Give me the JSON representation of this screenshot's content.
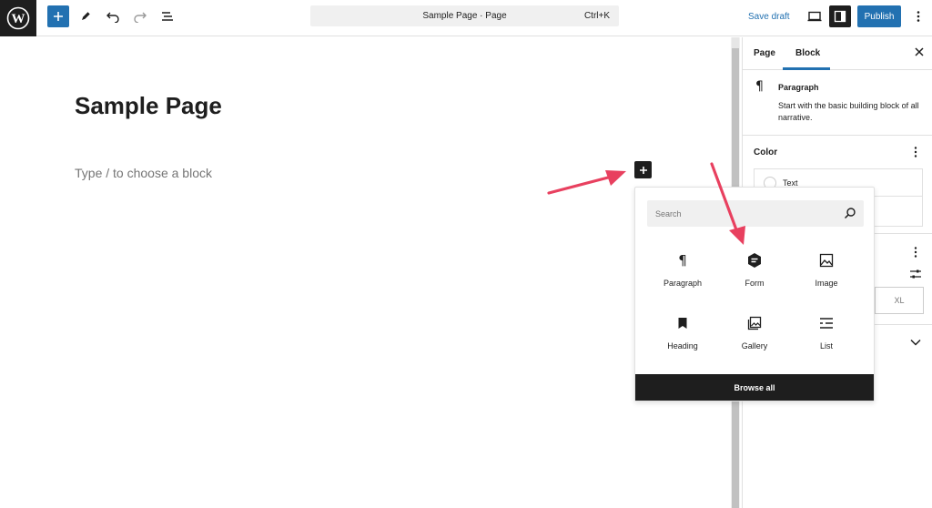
{
  "topbar": {
    "document_title": "Sample Page · Page",
    "shortcut": "Ctrl+K",
    "save_draft": "Save draft",
    "publish": "Publish"
  },
  "editor": {
    "title": "Sample Page",
    "block_placeholder": "Type / to choose a block"
  },
  "sidebar": {
    "tabs": [
      "Page",
      "Block"
    ],
    "active_tab": "Block",
    "block_card": {
      "title": "Paragraph",
      "description": "Start with the basic building block of all narrative."
    },
    "color_section": {
      "title": "Color",
      "text_label": "Text"
    },
    "size_option": "XL"
  },
  "inserter": {
    "search_placeholder": "Search",
    "blocks": [
      {
        "label": "Paragraph",
        "icon": "paragraph-icon"
      },
      {
        "label": "Form",
        "icon": "form-icon"
      },
      {
        "label": "Image",
        "icon": "image-icon"
      },
      {
        "label": "Heading",
        "icon": "heading-icon"
      },
      {
        "label": "Gallery",
        "icon": "gallery-icon"
      },
      {
        "label": "List",
        "icon": "list-icon"
      }
    ],
    "browse_all": "Browse all"
  },
  "colors": {
    "accent": "#2271b1",
    "dark": "#1e1e1e",
    "annotation_arrow": "#e8405f"
  }
}
